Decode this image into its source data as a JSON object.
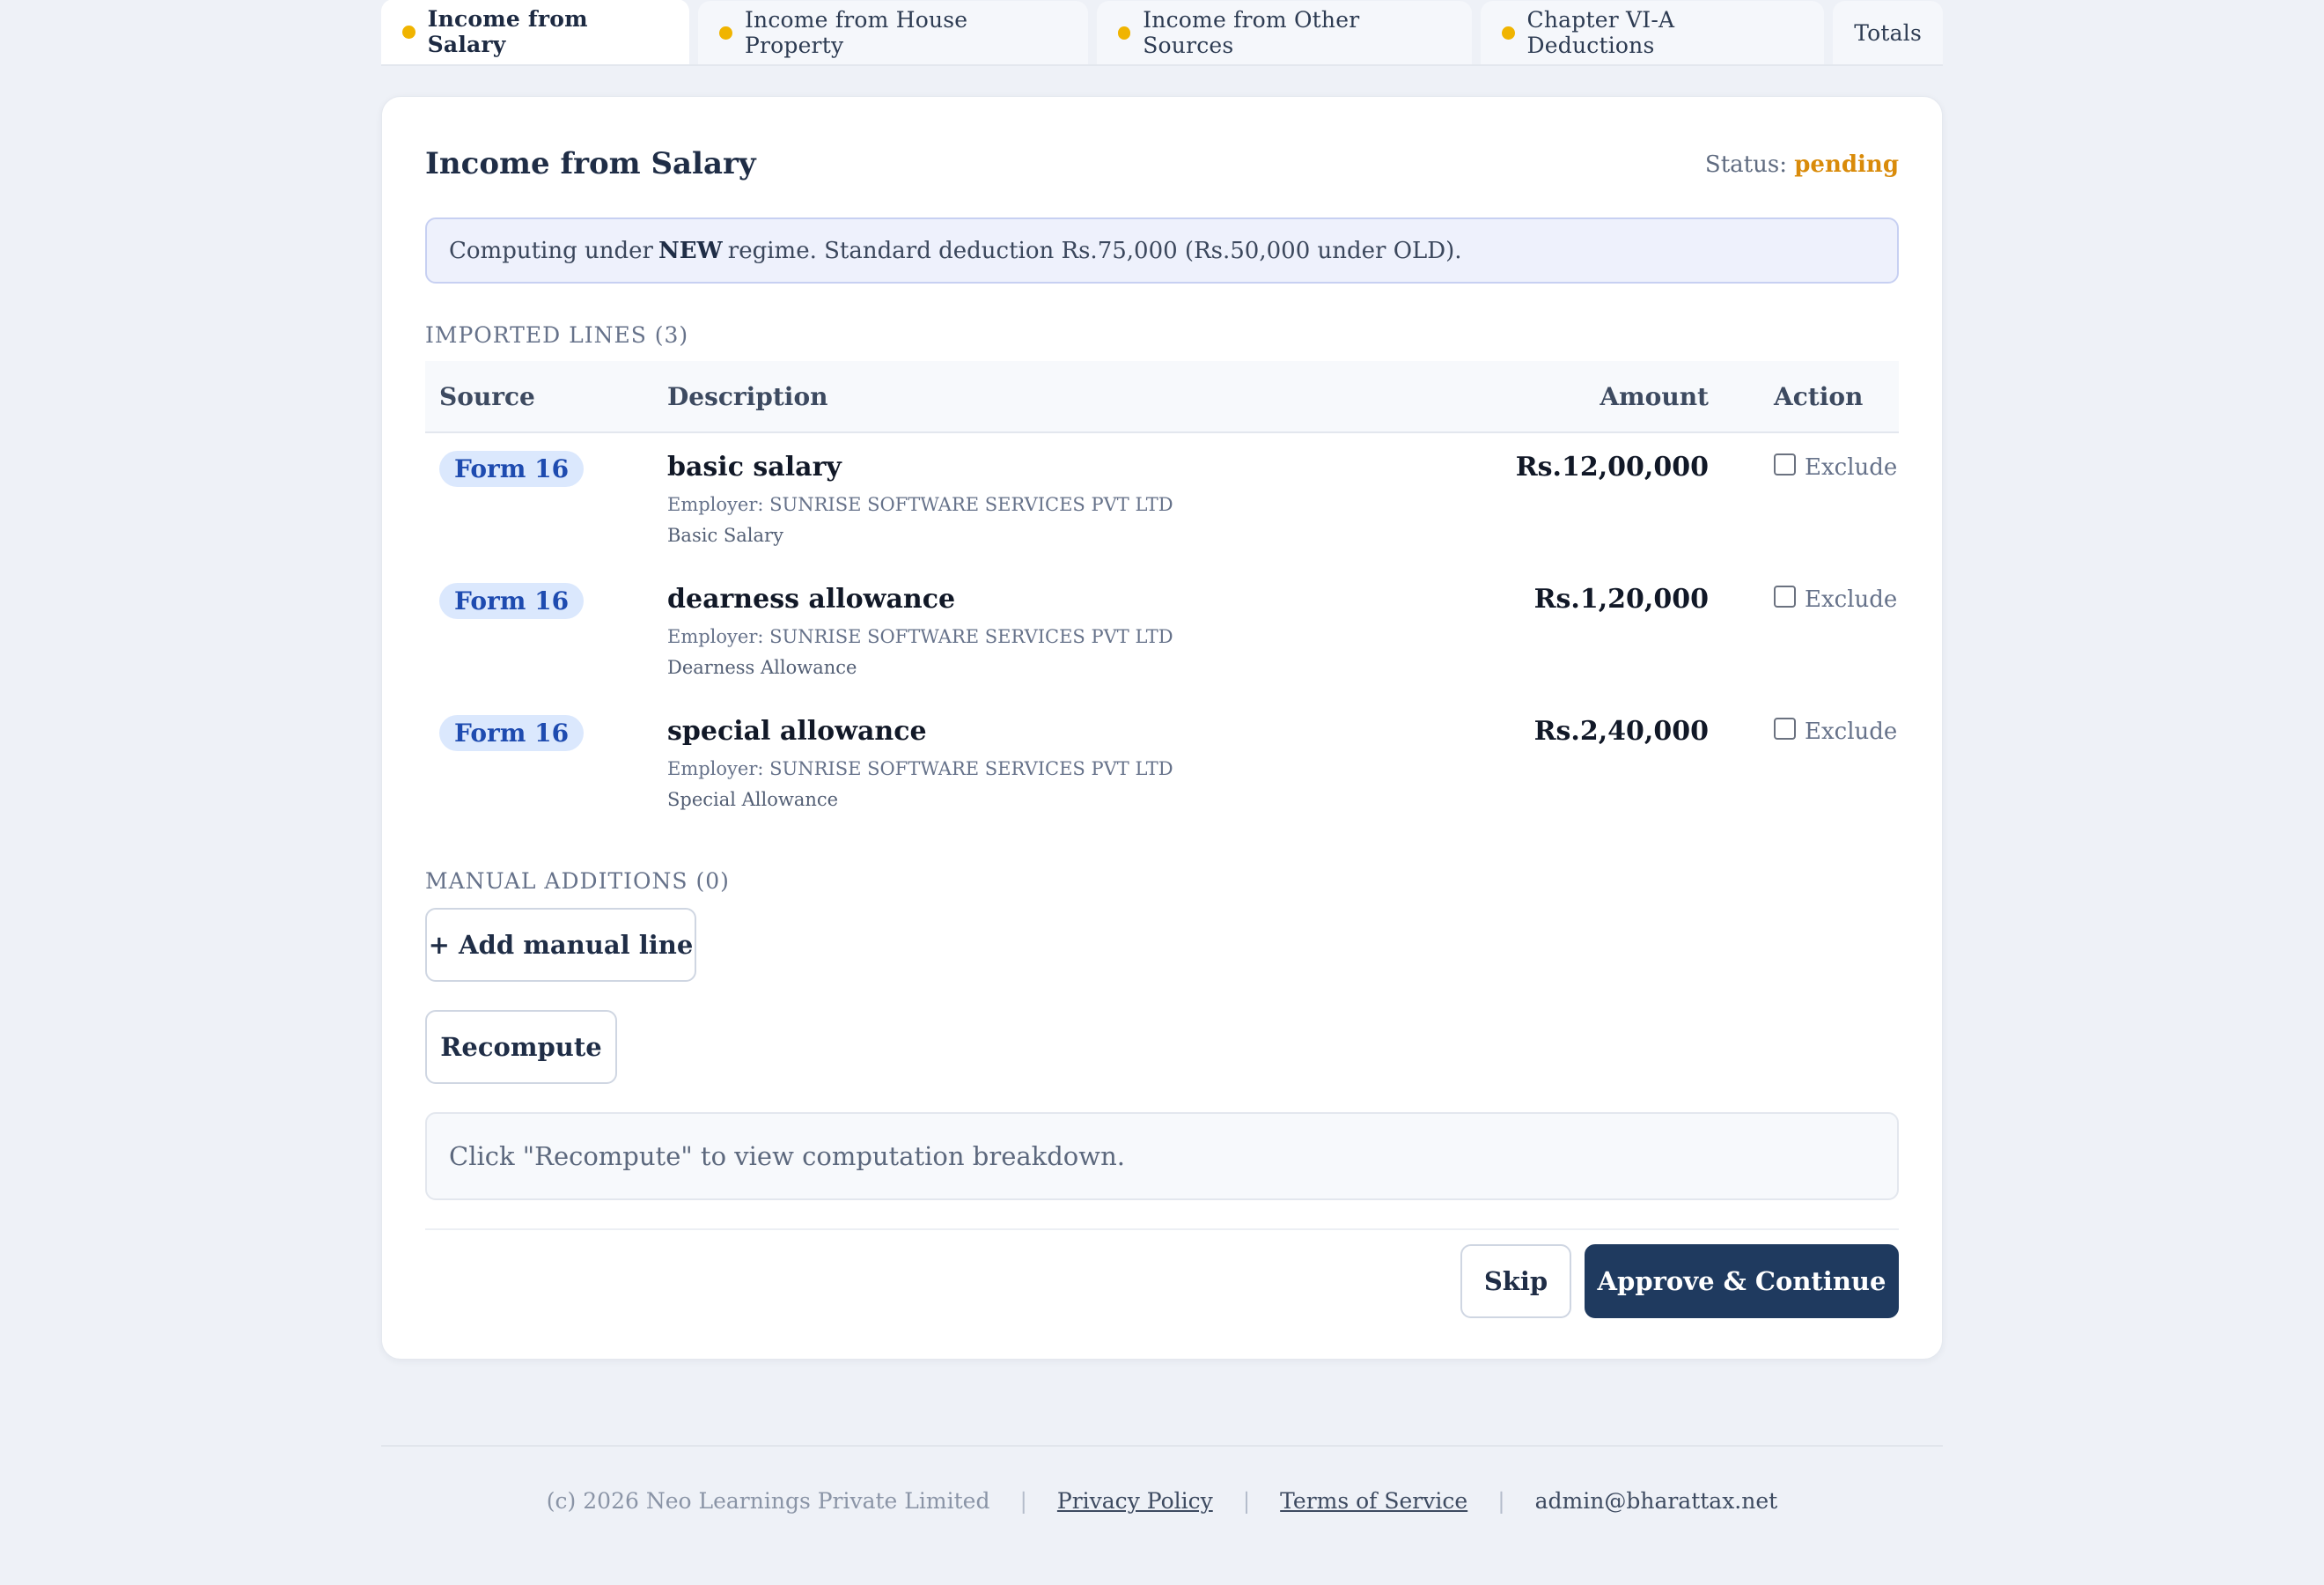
{
  "tabs": [
    {
      "label": "Income from Salary",
      "dot": true,
      "active": true
    },
    {
      "label": "Income from House Property",
      "dot": true
    },
    {
      "label": "Income from Other Sources",
      "dot": true
    },
    {
      "label": "Chapter VI-A Deductions",
      "dot": true
    },
    {
      "label": "Totals",
      "dot": false
    }
  ],
  "card": {
    "title": "Income from Salary",
    "status_label": "Status:",
    "status_value": "pending",
    "info_prefix": "Computing under",
    "info_regime": "NEW",
    "info_suffix": "regime. Standard deduction Rs.75,000 (Rs.50,000 under OLD)."
  },
  "imported": {
    "label": "IMPORTED LINES (3)",
    "columns": [
      "Source",
      "Description",
      "Amount",
      "Action"
    ],
    "rows": [
      {
        "source": "Form 16",
        "title": "basic salary",
        "employer": "Employer: SUNRISE SOFTWARE SERVICES PVT LTD",
        "detail": "Basic Salary",
        "amount": "Rs.12,00,000",
        "action": "Exclude"
      },
      {
        "source": "Form 16",
        "title": "dearness allowance",
        "employer": "Employer: SUNRISE SOFTWARE SERVICES PVT LTD",
        "detail": "Dearness Allowance",
        "amount": "Rs.1,20,000",
        "action": "Exclude"
      },
      {
        "source": "Form 16",
        "title": "special allowance",
        "employer": "Employer: SUNRISE SOFTWARE SERVICES PVT LTD",
        "detail": "Special Allowance",
        "amount": "Rs.2,40,000",
        "action": "Exclude"
      }
    ]
  },
  "manual": {
    "label": "MANUAL ADDITIONS (0)",
    "add_button": "+ Add manual line"
  },
  "recompute_button": "Recompute",
  "breakdown_note": "Click \"Recompute\" to view computation breakdown.",
  "actions": {
    "skip": "Skip",
    "approve": "Approve & Continue"
  },
  "footer": {
    "copyright": "(c) 2026 Neo Learnings Private Limited",
    "privacy": "Privacy Policy",
    "terms": "Terms of Service",
    "email": "admin@bharattax.net",
    "separator": "|"
  },
  "colors": {
    "accent": "#1f3a5f",
    "pending": "#d98b0a",
    "dot": "#f0b400",
    "badge_bg": "#dbe8fd",
    "badge_text": "#1e4bb0"
  }
}
